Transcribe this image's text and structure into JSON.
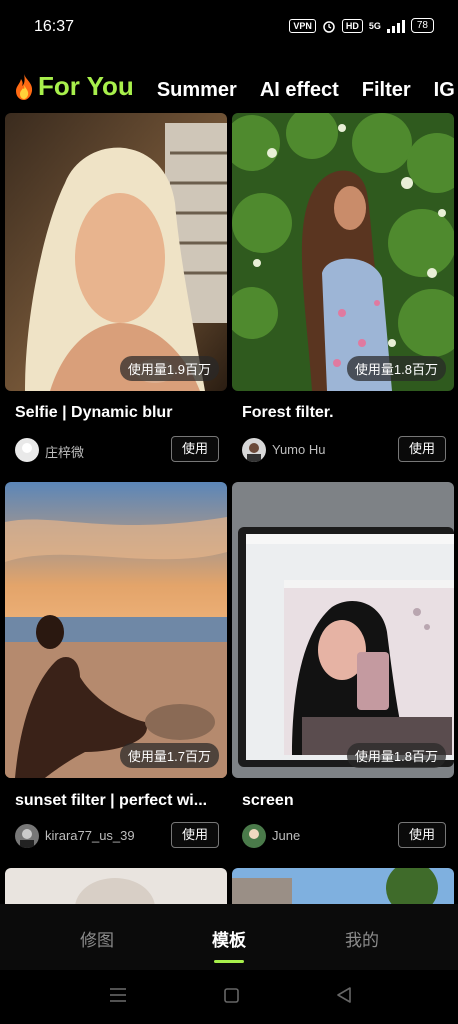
{
  "status_bar": {
    "time": "16:37",
    "vpn": "VPN",
    "hd": "HD",
    "network": "5G",
    "battery": "78"
  },
  "tabs": [
    {
      "label": "For You",
      "active": true
    },
    {
      "label": "Summer"
    },
    {
      "label": "AI effect"
    },
    {
      "label": "Filter"
    },
    {
      "label": "IG"
    }
  ],
  "cards": [
    {
      "title": "Selfie | Dynamic blur",
      "author": "庄梓微",
      "usage": "使用量1.9百万",
      "button": "使用"
    },
    {
      "title": "Forest filter.",
      "author": "Yumo Hu",
      "usage": "使用量1.8百万",
      "button": "使用"
    },
    {
      "title": "sunset filter | perfect wi...",
      "author": "kirara77_us_39",
      "usage": "使用量1.7百万",
      "button": "使用"
    },
    {
      "title": "screen",
      "author": "June",
      "usage": "使用量1.8百万",
      "button": "使用"
    }
  ],
  "bottom_nav": [
    {
      "label": "修图"
    },
    {
      "label": "模板",
      "active": true
    },
    {
      "label": "我的"
    }
  ],
  "colors": {
    "accent": "#a8f04c",
    "background": "#000000"
  }
}
